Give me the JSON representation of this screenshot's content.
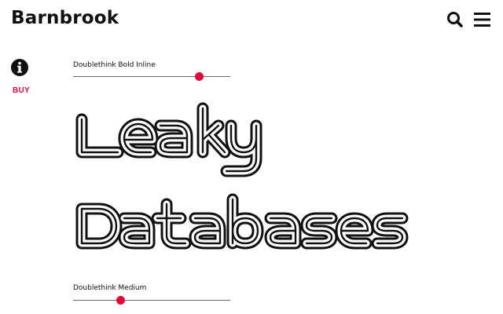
{
  "header": {
    "logo": "Barnbrook",
    "search_icon": "search-icon",
    "menu_icon": "hamburger-menu-icon"
  },
  "sidebar": {
    "info_icon": "info-icon",
    "buy_label": "BUY"
  },
  "specimens": [
    {
      "font_name": "Doublethink Bold Inline",
      "slider_value": 0.8,
      "lines": [
        "Leaky",
        "Databases"
      ]
    },
    {
      "font_name": "Doublethink Medium",
      "slider_value": 0.3
    }
  ],
  "colors": {
    "accent": "#e4003b",
    "text": "#111111",
    "background": "#ffffff",
    "track": "#6b6b6b"
  }
}
